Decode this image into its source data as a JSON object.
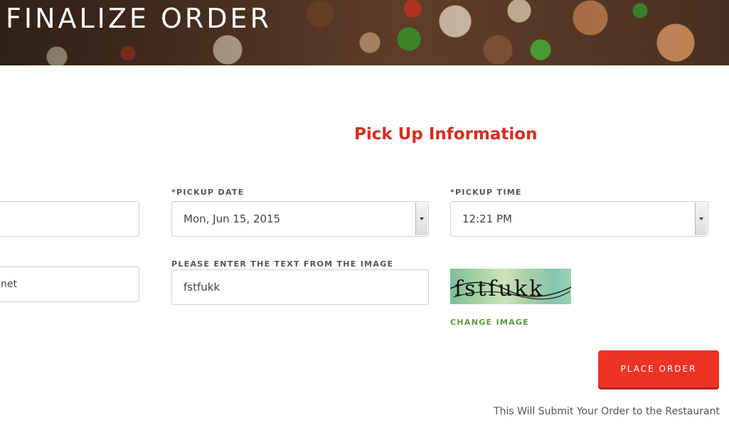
{
  "header": {
    "title": "FINALIZE ORDER"
  },
  "pickup": {
    "section_title": "Pick Up Information",
    "partial_field_1_value": "",
    "partial_field_2_value": "net",
    "date": {
      "label": "*PICKUP DATE",
      "selected": "Mon, Jun 15, 2015"
    },
    "time": {
      "label": "*PICKUP TIME",
      "selected": "12:21 PM"
    },
    "captcha": {
      "label": "PLEASE ENTER THE TEXT FROM THE IMAGE",
      "value": "fstfukk",
      "image_text": "fstfukk",
      "change_label": "CHANGE IMAGE"
    }
  },
  "actions": {
    "place_order_label": "PLACE ORDER",
    "footnote": "This Will Submit Your Order to the Restaurant"
  },
  "colors": {
    "accent_red": "#ee3325",
    "title_red": "#d82d22",
    "link_green": "#5a9a3a"
  }
}
